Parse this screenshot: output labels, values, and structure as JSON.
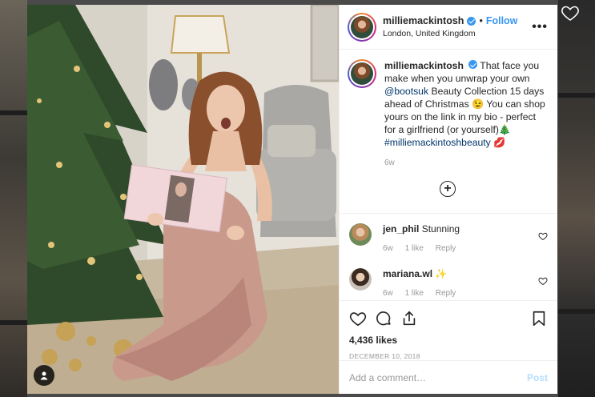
{
  "post": {
    "username": "milliemackintosh",
    "follow_label": "Follow",
    "dot": "•",
    "location": "London, United Kingdom",
    "more_label": "•••",
    "caption": {
      "username": "milliemackintosh",
      "text_before_link": "That face you make when you unwrap your own ",
      "mention": "@bootsuk",
      "text_after_link": " Beauty Collection 15 days ahead of Christmas 😉 You can shop yours on the link in my bio - perfect for a girlfriend (or yourself)🎄",
      "hashtag": "#milliemackintoshbeauty",
      "hashtag_emoji": " 💋",
      "time": "6w"
    },
    "load_more_label": "+",
    "comments": [
      {
        "username": "jen_phil",
        "text": "Stunning",
        "time": "6w",
        "likes": "1 like",
        "reply": "Reply"
      },
      {
        "username": "mariana.wl",
        "text": "✨",
        "time": "6w",
        "likes": "1 like",
        "reply": "Reply"
      }
    ],
    "likes": "4,436 likes",
    "date": "DECEMBER 10, 2018",
    "comment_placeholder": "Add a comment…",
    "post_label": "Post"
  },
  "icons": {
    "close": "close-icon",
    "like": "heart-icon",
    "comment": "comment-icon",
    "share": "share-icon",
    "save": "bookmark-icon",
    "user_tag": "person-icon"
  },
  "colors": {
    "accent": "#3897f0",
    "link": "#003569",
    "muted": "#999999",
    "post_disabled": "#b2dffc"
  }
}
